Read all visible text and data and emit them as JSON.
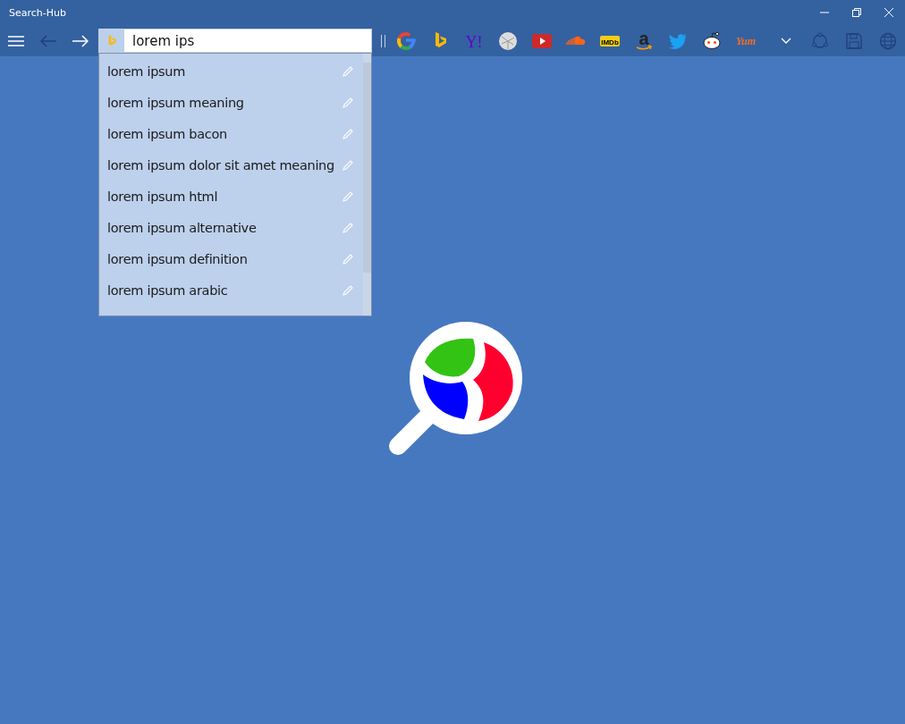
{
  "window": {
    "title": "Search-Hub"
  },
  "search": {
    "value": "lorem ips"
  },
  "suggestions": [
    {
      "text": "lorem ipsum"
    },
    {
      "text": "lorem ipsum meaning"
    },
    {
      "text": "lorem ipsum bacon"
    },
    {
      "text": "lorem ipsum dolor sit amet meaning"
    },
    {
      "text": "lorem ipsum html"
    },
    {
      "text": "lorem ipsum alternative"
    },
    {
      "text": "lorem ipsum definition"
    },
    {
      "text": "lorem ipsum arabic"
    }
  ],
  "engines": [
    {
      "kind": "google",
      "selected": false
    },
    {
      "kind": "bing",
      "selected": true
    },
    {
      "kind": "yahoo",
      "label": "Y!",
      "selected": false
    },
    {
      "kind": "wikipedia",
      "selected": false
    },
    {
      "kind": "youtube",
      "selected": false
    },
    {
      "kind": "soundcloud",
      "selected": false
    },
    {
      "kind": "imdb",
      "label": "IMDb",
      "selected": false
    },
    {
      "kind": "amazon",
      "label": "a",
      "selected": false
    },
    {
      "kind": "twitter",
      "selected": false
    },
    {
      "kind": "reddit",
      "selected": false
    },
    {
      "kind": "yum",
      "label": "Yum",
      "selected": false
    }
  ]
}
